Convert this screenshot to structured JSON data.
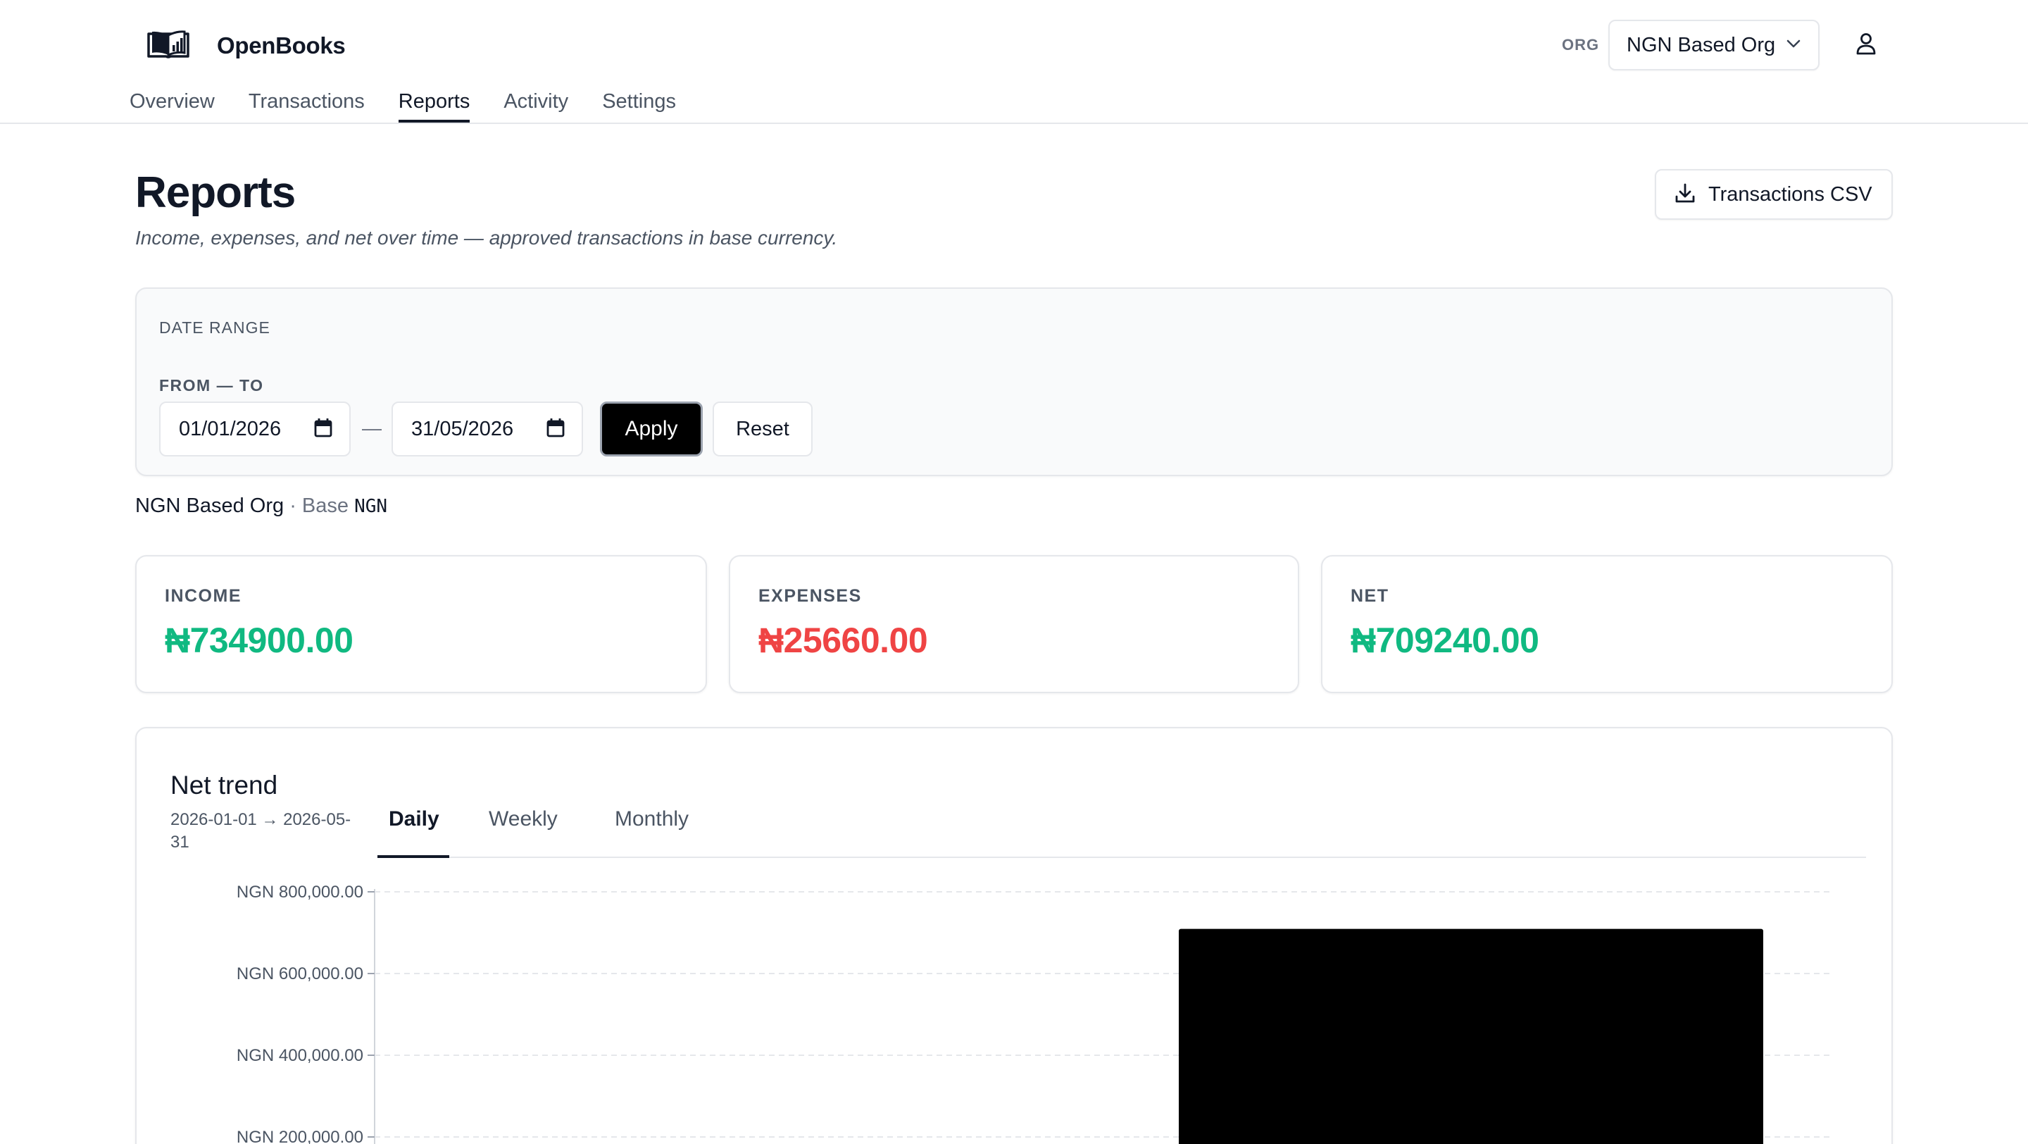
{
  "header": {
    "brand": "OpenBooks",
    "org_label": "ORG",
    "org_value": "NGN Based Org",
    "tabs": [
      "Overview",
      "Transactions",
      "Reports",
      "Activity",
      "Settings"
    ],
    "active_tab": "Reports"
  },
  "page": {
    "title": "Reports",
    "subtitle": "Income, expenses, and net over time — approved transactions in base currency.",
    "csv_button": "Transactions CSV"
  },
  "range": {
    "title": "DATE RANGE",
    "label": "FROM — TO",
    "from": "01/01/2026",
    "separator": "—",
    "to": "31/05/2026",
    "apply": "Apply",
    "reset": "Reset"
  },
  "base": {
    "org": "NGN Based Org",
    "dot": " · ",
    "base_label": "Base",
    "currency": "NGN"
  },
  "stats": [
    {
      "label": "INCOME",
      "value": "₦734900.00",
      "color": "#10b981"
    },
    {
      "label": "EXPENSES",
      "value": "₦25660.00",
      "color": "#ef4444"
    },
    {
      "label": "NET",
      "value": "₦709240.00",
      "color": "#10b981"
    }
  ],
  "chart": {
    "title": "Net trend",
    "range": "2026-01-01 → 2026-05-31",
    "tabs": [
      "Daily",
      "Weekly",
      "Monthly"
    ],
    "active_tab": "Daily"
  },
  "chart_data": {
    "type": "bar",
    "title": "Net trend",
    "y_ticks": [
      "NGN 200,000.00",
      "NGN 400,000.00",
      "NGN 600,000.00",
      "NGN 800,000.00"
    ],
    "ylim": [
      0,
      800000
    ],
    "grid": true,
    "bar_color": "#000000",
    "values": [
      709240
    ]
  }
}
